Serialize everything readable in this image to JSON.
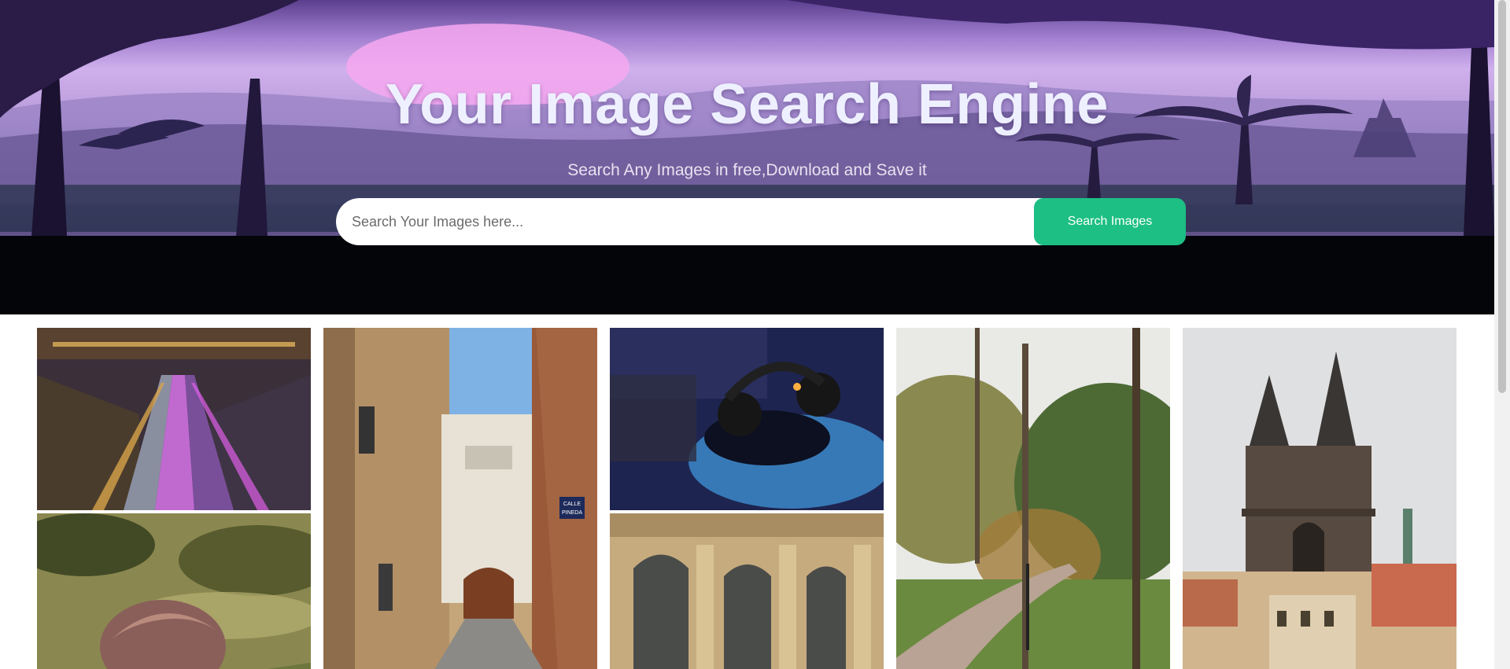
{
  "hero": {
    "title": "Your Image Search Engine",
    "subtitle": "Search Any Images in free,Download and Save it"
  },
  "search": {
    "placeholder": "Search Your Images here...",
    "button_label": "Search Images"
  },
  "gallery": {
    "images": [
      {
        "subject": "escalators-photo"
      },
      {
        "subject": "woman-behind-leaves-photo"
      },
      {
        "subject": "narrow-street-photo",
        "sign_text": [
          "CALLE",
          "PINEDA"
        ]
      },
      {
        "subject": "dj-headphones-photo"
      },
      {
        "subject": "building-facade-photo"
      },
      {
        "subject": "park-path-photo"
      },
      {
        "subject": "gothic-church-photo"
      }
    ]
  },
  "colors": {
    "accent": "#1dbf84",
    "title": "#eef0ff"
  }
}
